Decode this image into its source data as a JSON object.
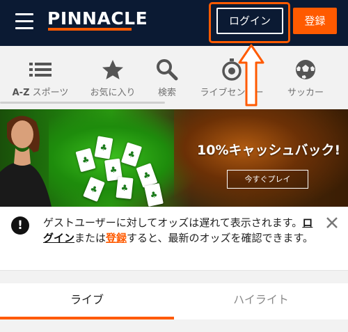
{
  "header": {
    "logo": "PINNACLE",
    "login_label": "ログイン",
    "register_label": "登録",
    "menu_icon": "hamburger-icon"
  },
  "nav": {
    "items": [
      {
        "label_prefix": "A-Z",
        "label": " スポーツ",
        "icon": "list-icon"
      },
      {
        "label": "お気に入り",
        "icon": "star-icon"
      },
      {
        "label": "検索",
        "icon": "search-icon"
      },
      {
        "label": "ライブセンター",
        "icon": "stopwatch-icon"
      },
      {
        "label": "サッカー",
        "icon": "soccer-ball-icon"
      }
    ]
  },
  "banner": {
    "title": "10%キャッシュバック!",
    "button_label": "今すぐプレイ"
  },
  "notice": {
    "text_1": "ゲストユーザーに対してオッズは遅れて表示されます。",
    "login_link": "ログイン",
    "text_2": "または",
    "register_link": "登録",
    "text_3": "すると、最新のオッズを確認できます。"
  },
  "tabs": [
    {
      "label": "ライブ"
    },
    {
      "label": "ハイライト"
    }
  ],
  "colors": {
    "header_bg": "#0b1a33",
    "accent": "#ff5a00",
    "page_bg": "#f2f2f2"
  }
}
